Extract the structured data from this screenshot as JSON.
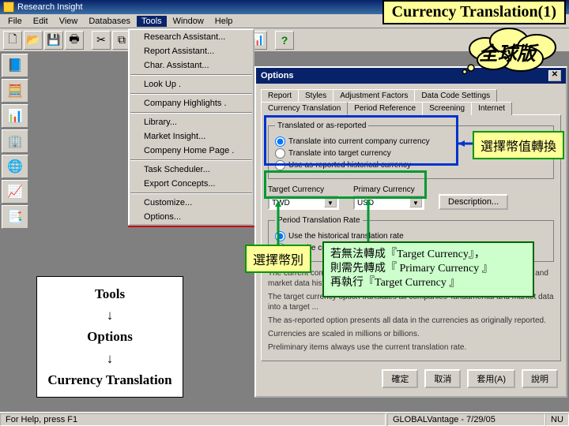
{
  "slide_title": "Currency Translation(1)",
  "cloud_label": "全球版",
  "app_title": "Research Insight",
  "menus": [
    "File",
    "Edit",
    "View",
    "Databases",
    "Tools",
    "Window",
    "Help"
  ],
  "open_menu_index": 4,
  "tools_menu": {
    "groups": [
      [
        "Research Assistant...",
        "Report Assistant...",
        "Char. Assistant..."
      ],
      [
        "Look Up ."
      ],
      [
        "Company Highlights ."
      ],
      [
        "Library...",
        "Market Insight...",
        "Compeny Home Page ."
      ],
      [
        "Task Scheduler...",
        "Export Concepts..."
      ],
      [
        "Customize...",
        "Options..."
      ]
    ],
    "highlight_item": "Options..."
  },
  "options_dialog": {
    "title": "Options",
    "tabs_row1": [
      "Report",
      "Styles",
      "Adjustment Factors",
      "Data Code Settings"
    ],
    "tabs_row2": [
      "Currency Translation",
      "Period Reference",
      "Screening",
      "Internet"
    ],
    "active_tab": "Currency Translation",
    "group1": {
      "legend": "Translated or as-reported",
      "options": [
        "Translate into current company currency",
        "Translate into target currency",
        "Use as-reported historical currency"
      ],
      "selected": 0
    },
    "target_label": "Target Currency",
    "target_value": "TWD",
    "primary_label": "Primary Currency",
    "primary_value": "USD",
    "desc_btn": "Description...",
    "group2": {
      "legend": "Period Translation Rate",
      "options": [
        "Use the historical translation rate",
        "Use the current translation rate"
      ],
      "selected": 0
    },
    "body_texts": [
      "The current company currency option translates all companies' fundamental and market data history as ...",
      "The target currency option translates all companies' fundamental and market data into a target ...",
      "The as-reported option presents all data in the currencies as originally reported.",
      "Currencies are scaled in millions or billions.",
      "Preliminary items always use the current translation rate."
    ],
    "buttons": [
      "確定",
      "取消",
      "套用(A)",
      "說明"
    ]
  },
  "callouts": {
    "select_translation": "選擇幣值轉換",
    "select_currency": "選擇幣別",
    "hint_lines": [
      "若無法轉成『Target Currency』，",
      "則需先轉成『 Primary Currency 』",
      "再執行『Target Currency 』"
    ]
  },
  "path_steps": [
    "Tools",
    "↓",
    "Options",
    "↓",
    "Currency Translation"
  ],
  "status_left": "For Help, press F1",
  "status_right": "GLOBALVantage - 7/29/05"
}
